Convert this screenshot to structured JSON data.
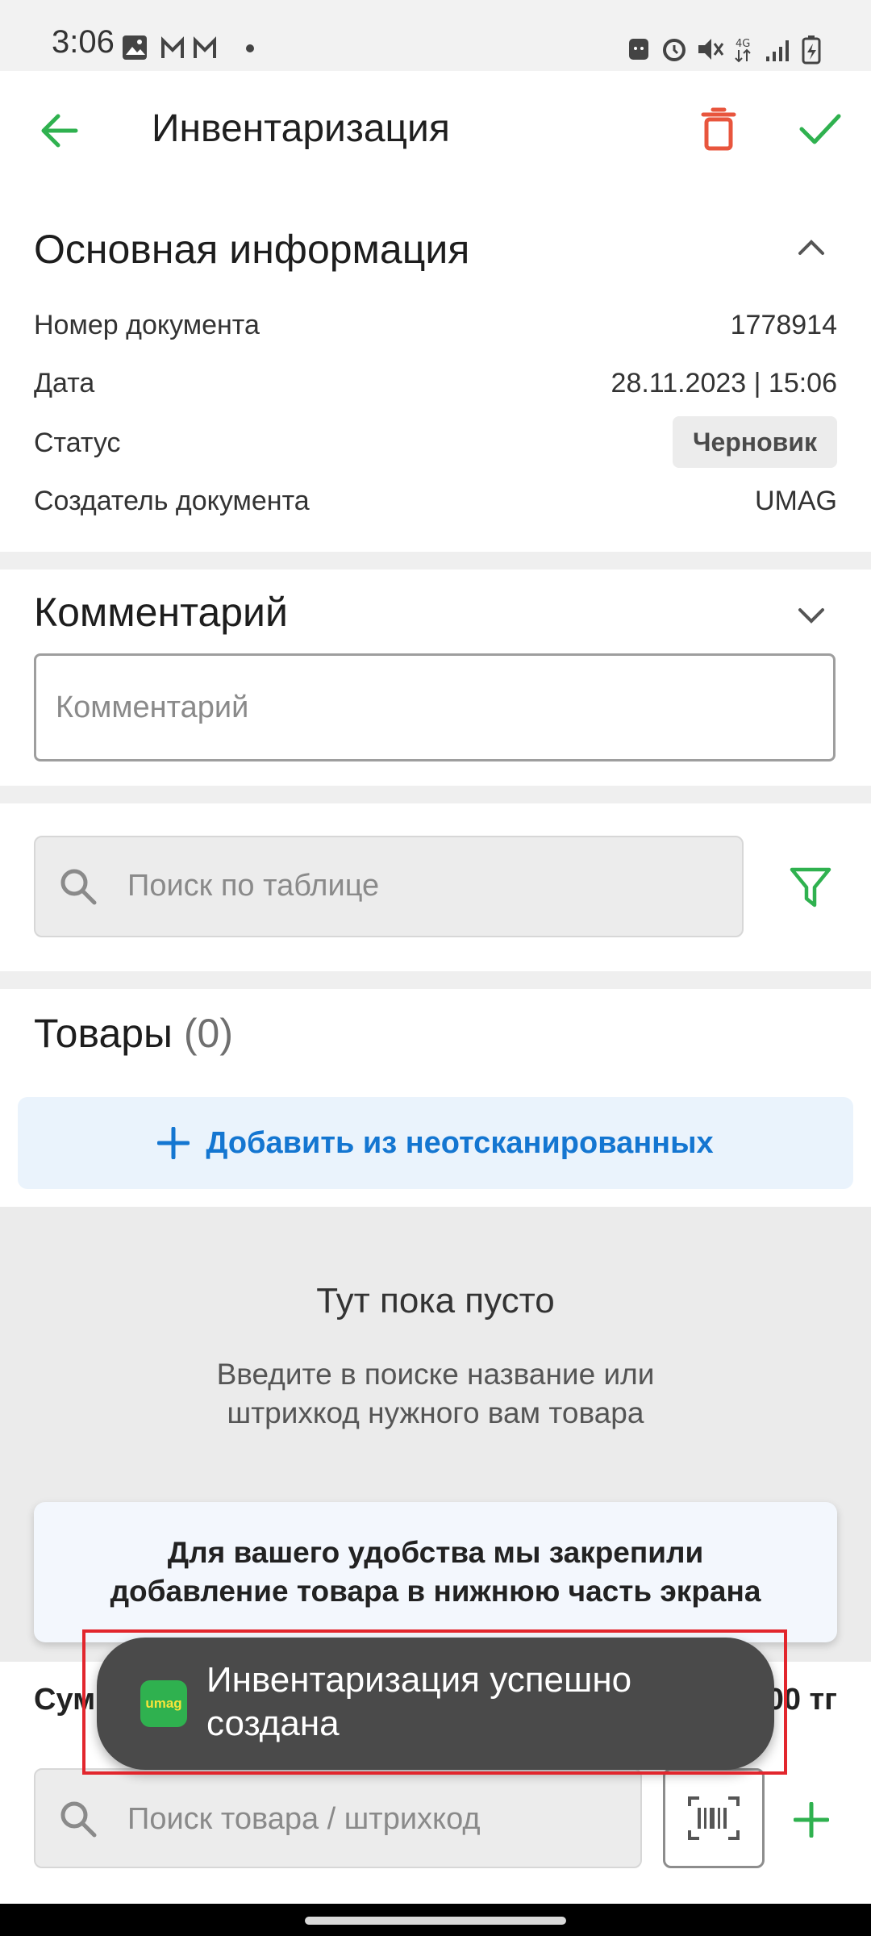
{
  "status_bar": {
    "time": "3:06",
    "icons": [
      "image-icon",
      "gmail-icon",
      "gmail-icon",
      "dot-icon",
      "android-icon",
      "alarm-icon",
      "mute-icon",
      "4g-icon",
      "signal-icon",
      "battery-charging-icon"
    ],
    "network_label": "4G"
  },
  "app_bar": {
    "title": "Инвентаризация",
    "back_icon": "arrow-left-icon",
    "delete_icon": "trash-icon",
    "confirm_icon": "check-icon"
  },
  "basic_info": {
    "title": "Основная информация",
    "rows": [
      {
        "label": "Номер документа",
        "value": "1778914"
      },
      {
        "label": "Дата",
        "value": "28.11.2023 | 15:06"
      },
      {
        "label": "Статус",
        "value": "Черновик"
      },
      {
        "label": "Создатель документа",
        "value": "UMAG"
      }
    ]
  },
  "comment": {
    "title": "Комментарий",
    "placeholder": "Комментарий"
  },
  "table_search": {
    "placeholder": "Поиск по таблице"
  },
  "goods": {
    "title": "Товары",
    "count": "(0)",
    "add_label": "Добавить из неотсканированных"
  },
  "empty_state": {
    "title": "Тут пока пусто",
    "line1": "Введите в поиске название или",
    "line2": "штрихкод нужного вам товара"
  },
  "hint": {
    "line1": "Для вашего удобства мы закрепили",
    "line2": "добавление товара в нижнюю часть экрана"
  },
  "summary": {
    "label": "Сумма закупочной",
    "value": "0.00 тг"
  },
  "bottom_search": {
    "placeholder": "Поиск товара / штрихкод"
  },
  "toast": {
    "logo_text": "umag",
    "line1": "Инвентаризация успешно",
    "line2": "создана"
  },
  "colors": {
    "accent_green": "#2fb14f",
    "delete_red": "#e8553d",
    "link_blue": "#1476d1",
    "highlight_red": "#e2262d"
  }
}
